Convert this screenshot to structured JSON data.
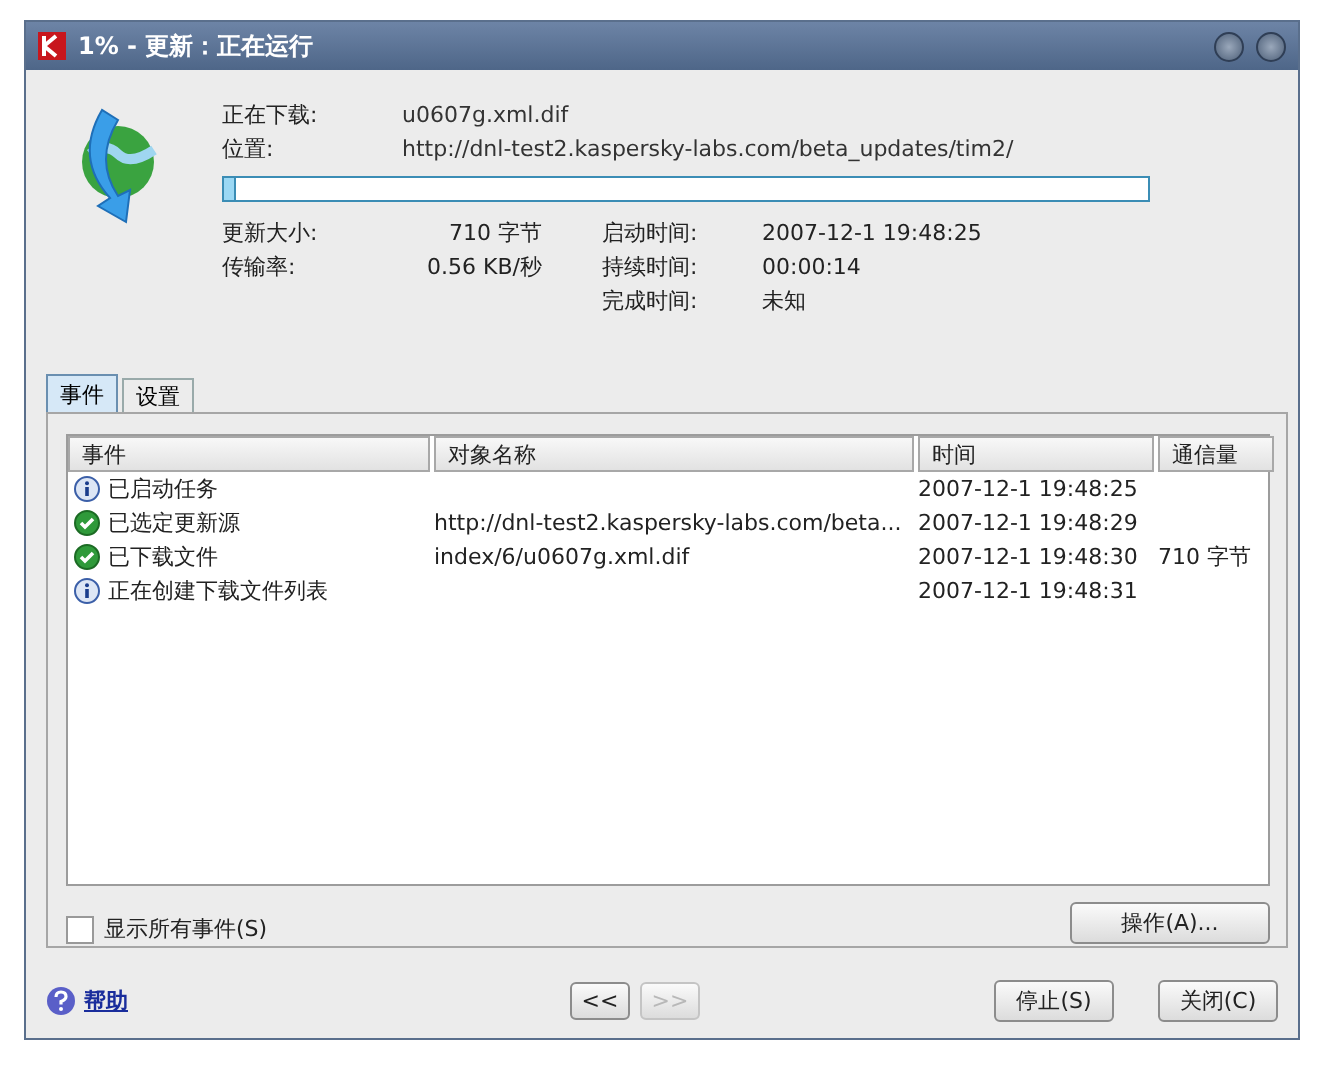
{
  "window": {
    "title": "1% - 更新：正在运行"
  },
  "download": {
    "fields": [
      {
        "label": "正在下载:",
        "value": "u0607g.xml.dif"
      },
      {
        "label": "位置:",
        "value": "http://dnl-test2.kaspersky-labs.com/beta_updates/tim2/"
      }
    ],
    "level": 0.01
  },
  "stats": [
    {
      "label": "更新大小:",
      "value": "710 字节"
    },
    {
      "label": "启动时间:",
      "value": "2007-12-1 19:48:25"
    },
    {
      "label": "传输率:",
      "value": "0.56 KB/秒"
    },
    {
      "label": "持续时间:",
      "value": "00:00:14"
    },
    {
      "label": "完成时间:",
      "value": "未知"
    }
  ],
  "tabs": [
    {
      "label": "事件",
      "selected": true
    },
    {
      "label": "设置",
      "selected": false
    }
  ],
  "table": {
    "columns": [
      "事件",
      "对象名称",
      "时间",
      "通信量"
    ],
    "rows": [
      {
        "kind": "info",
        "event": "已启动任务",
        "object": "",
        "time": "2007-12-1 19:48:25",
        "traffic": ""
      },
      {
        "kind": "success",
        "event": "已选定更新源",
        "object": "http://dnl-test2.kaspersky-labs.com/beta...",
        "time": "2007-12-1 19:48:29",
        "traffic": ""
      },
      {
        "kind": "success",
        "event": "已下载文件",
        "object": "index/6/u0607g.xml.dif",
        "time": "2007-12-1 19:48:30",
        "traffic": "710 字节"
      },
      {
        "kind": "info",
        "event": "正在创建下载文件列表",
        "object": "",
        "time": "2007-12-1 19:48:31",
        "traffic": ""
      }
    ]
  },
  "show_all": {
    "label": "显示所有事件(S)",
    "checked": false
  },
  "actions_button": "操作(A)...",
  "help_link": "帮助",
  "nav_buttons": [
    {
      "label": "<<",
      "disabled": false
    },
    {
      "label": ">>",
      "disabled": true
    }
  ],
  "buttons": [
    "停止(S)",
    "关闭(C)"
  ]
}
